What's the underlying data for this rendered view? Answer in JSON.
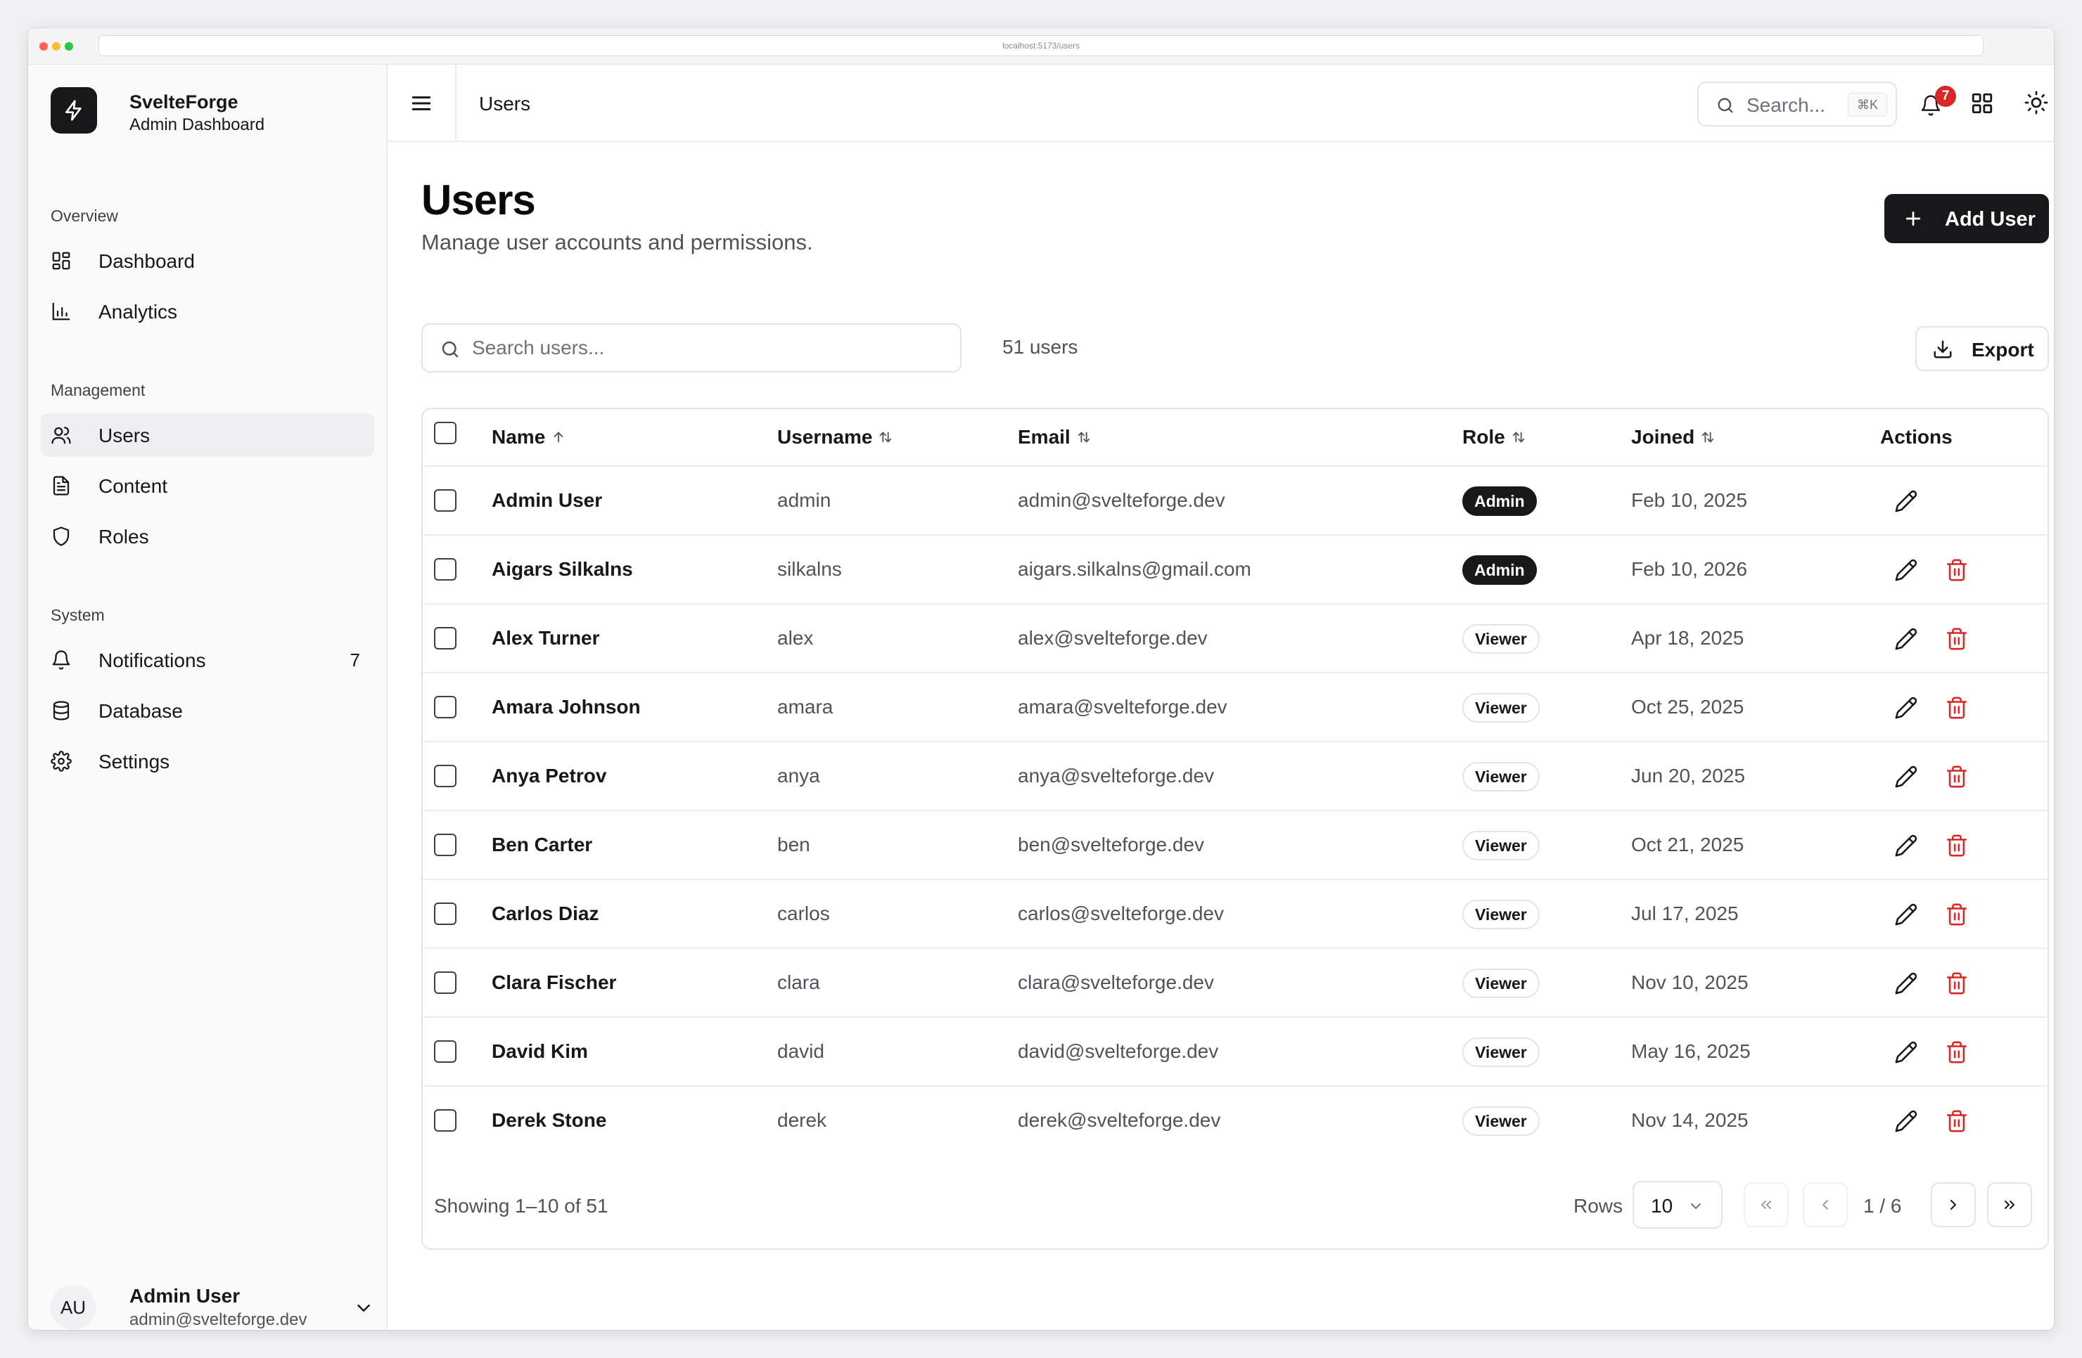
{
  "browser": {
    "url": "localhost:5173/users"
  },
  "brand": {
    "name": "SvelteForge",
    "subtitle": "Admin Dashboard",
    "logo_icon": "lightning-icon"
  },
  "sidebar": {
    "groups": [
      {
        "label": "Overview",
        "items": [
          {
            "label": "Dashboard",
            "icon": "dashboard-icon"
          },
          {
            "label": "Analytics",
            "icon": "bar-chart-icon"
          }
        ]
      },
      {
        "label": "Management",
        "items": [
          {
            "label": "Users",
            "icon": "users-icon",
            "active": true
          },
          {
            "label": "Content",
            "icon": "document-icon"
          },
          {
            "label": "Roles",
            "icon": "shield-icon"
          }
        ]
      },
      {
        "label": "System",
        "items": [
          {
            "label": "Notifications",
            "icon": "bell-icon",
            "count": "7"
          },
          {
            "label": "Database",
            "icon": "database-icon"
          },
          {
            "label": "Settings",
            "icon": "gear-icon"
          }
        ]
      }
    ],
    "user": {
      "initials": "AU",
      "name": "Admin User",
      "email": "admin@svelteforge.dev"
    }
  },
  "topbar": {
    "title": "Users",
    "search_placeholder": "Search...",
    "search_shortcut": "⌘K",
    "notification_count": "7"
  },
  "page": {
    "title": "Users",
    "subtitle": "Manage user accounts and permissions.",
    "add_button": "Add User",
    "search_placeholder": "Search users...",
    "user_count": "51 users",
    "export_button": "Export"
  },
  "table": {
    "columns": {
      "name": "Name",
      "username": "Username",
      "email": "Email",
      "role": "Role",
      "joined": "Joined",
      "actions": "Actions"
    },
    "rows": [
      {
        "name": "Admin User",
        "username": "admin",
        "email": "admin@svelteforge.dev",
        "role": "Admin",
        "joined": "Feb 10, 2025",
        "deletable": false
      },
      {
        "name": "Aigars Silkalns",
        "username": "silkalns",
        "email": "aigars.silkalns@gmail.com",
        "role": "Admin",
        "joined": "Feb 10, 2026",
        "deletable": true
      },
      {
        "name": "Alex Turner",
        "username": "alex",
        "email": "alex@svelteforge.dev",
        "role": "Viewer",
        "joined": "Apr 18, 2025",
        "deletable": true
      },
      {
        "name": "Amara Johnson",
        "username": "amara",
        "email": "amara@svelteforge.dev",
        "role": "Viewer",
        "joined": "Oct 25, 2025",
        "deletable": true
      },
      {
        "name": "Anya Petrov",
        "username": "anya",
        "email": "anya@svelteforge.dev",
        "role": "Viewer",
        "joined": "Jun 20, 2025",
        "deletable": true
      },
      {
        "name": "Ben Carter",
        "username": "ben",
        "email": "ben@svelteforge.dev",
        "role": "Viewer",
        "joined": "Oct 21, 2025",
        "deletable": true
      },
      {
        "name": "Carlos Diaz",
        "username": "carlos",
        "email": "carlos@svelteforge.dev",
        "role": "Viewer",
        "joined": "Jul 17, 2025",
        "deletable": true
      },
      {
        "name": "Clara Fischer",
        "username": "clara",
        "email": "clara@svelteforge.dev",
        "role": "Viewer",
        "joined": "Nov 10, 2025",
        "deletable": true
      },
      {
        "name": "David Kim",
        "username": "david",
        "email": "david@svelteforge.dev",
        "role": "Viewer",
        "joined": "May 16, 2025",
        "deletable": true
      },
      {
        "name": "Derek Stone",
        "username": "derek",
        "email": "derek@svelteforge.dev",
        "role": "Viewer",
        "joined": "Nov 14, 2025",
        "deletable": true
      }
    ],
    "footer": {
      "showing": "Showing 1–10 of 51",
      "rows_label": "Rows",
      "rows_value": "10",
      "page_info": "1 / 6"
    }
  },
  "colors": {
    "accent": "#18181b",
    "danger": "#dc2626",
    "badge": "#dc2626",
    "muted": "#52525b"
  }
}
